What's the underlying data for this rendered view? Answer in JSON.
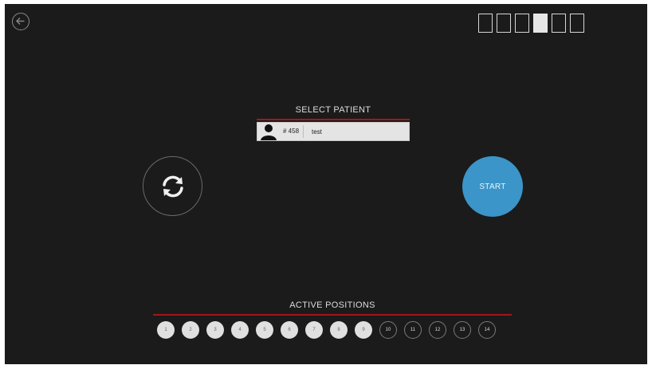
{
  "select_patient": {
    "title": "SELECT PATIENT",
    "patient_id": "# 458",
    "patient_name": "test"
  },
  "start_label": "START",
  "active_positions": {
    "title": "ACTIVE POSITIONS",
    "items": [
      {
        "label": "1",
        "active": true
      },
      {
        "label": "2",
        "active": true
      },
      {
        "label": "3",
        "active": true
      },
      {
        "label": "4",
        "active": true
      },
      {
        "label": "5",
        "active": true
      },
      {
        "label": "6",
        "active": true
      },
      {
        "label": "7",
        "active": true
      },
      {
        "label": "8",
        "active": true
      },
      {
        "label": "9",
        "active": true
      },
      {
        "label": "10",
        "active": false
      },
      {
        "label": "11",
        "active": false
      },
      {
        "label": "12",
        "active": false
      },
      {
        "label": "13",
        "active": false
      },
      {
        "label": "14",
        "active": false
      }
    ]
  },
  "progress_steps": {
    "count": 6,
    "active_index": 3
  },
  "colors": {
    "background": "#1b1b1b",
    "accent_red": "#a01818",
    "start_blue": "#3b95c8"
  },
  "icons": {
    "back": "arrow-left-circle-icon",
    "refresh": "refresh-icon",
    "patient": "user-silhouette-icon"
  }
}
